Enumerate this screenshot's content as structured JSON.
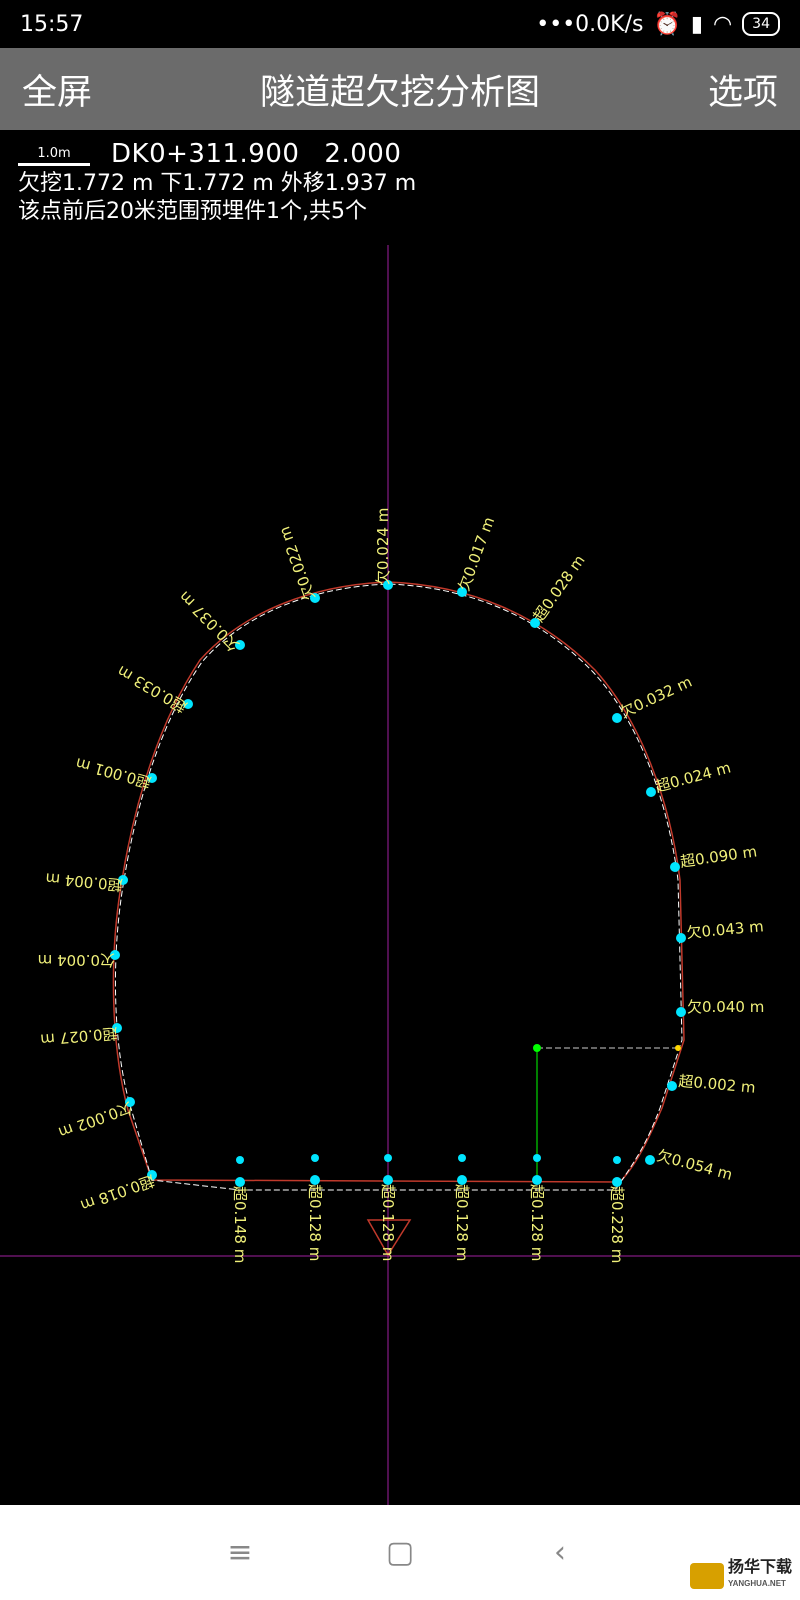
{
  "status": {
    "time": "15:57",
    "net": "•••0.0K/s",
    "battery": "34"
  },
  "toolbar": {
    "fullscreen": "全屏",
    "title": "隧道超欠挖分析图",
    "options": "选项"
  },
  "info": {
    "scale": "1.0m",
    "station": "DK0+311.900",
    "elevation": "2.000",
    "line2": "欠挖1.772 m  下1.772 m  外移1.937 m",
    "line3": "该点前后20米范围预埋件1个,共5个"
  },
  "colors": {
    "background": "#000000",
    "toolbar": "#6b6b6b",
    "profile": "#c0392b",
    "axis": "#a020a0",
    "points": "#00e5ff",
    "labels": "#f0f07a",
    "aux": "#00ff00"
  },
  "measurements": [
    {
      "label": "超0.018 m"
    },
    {
      "label": "欠0.002 m"
    },
    {
      "label": "超0.027 m"
    },
    {
      "label": "欠0.004 m"
    },
    {
      "label": "超0.004 m"
    },
    {
      "label": "超0.001 m"
    },
    {
      "label": "超0.033 m"
    },
    {
      "label": "欠0.037 m"
    },
    {
      "label": "欠0.022 m"
    },
    {
      "label": "欠0.024 m"
    },
    {
      "label": "欠0.017 m"
    },
    {
      "label": "超0.028 m"
    },
    {
      "label": "欠0.032 m"
    },
    {
      "label": "超0.024 m"
    },
    {
      "label": "超0.090 m"
    },
    {
      "label": "欠0.043 m"
    },
    {
      "label": "欠0.040 m"
    },
    {
      "label": "超0.002 m"
    },
    {
      "label": "欠0.054 m"
    },
    {
      "label": "超0.228 m"
    },
    {
      "label": "超0.128 m"
    },
    {
      "label": "超0.128 m"
    },
    {
      "label": "超0.128 m"
    },
    {
      "label": "超0.128 m"
    },
    {
      "label": "超0.148 m"
    }
  ],
  "nav": {
    "menu_icon": "menu-icon",
    "home_icon": "home-icon",
    "back_icon": "back-icon"
  },
  "watermark": {
    "text": "扬华下载",
    "sub": "YANGHUA.NET"
  }
}
